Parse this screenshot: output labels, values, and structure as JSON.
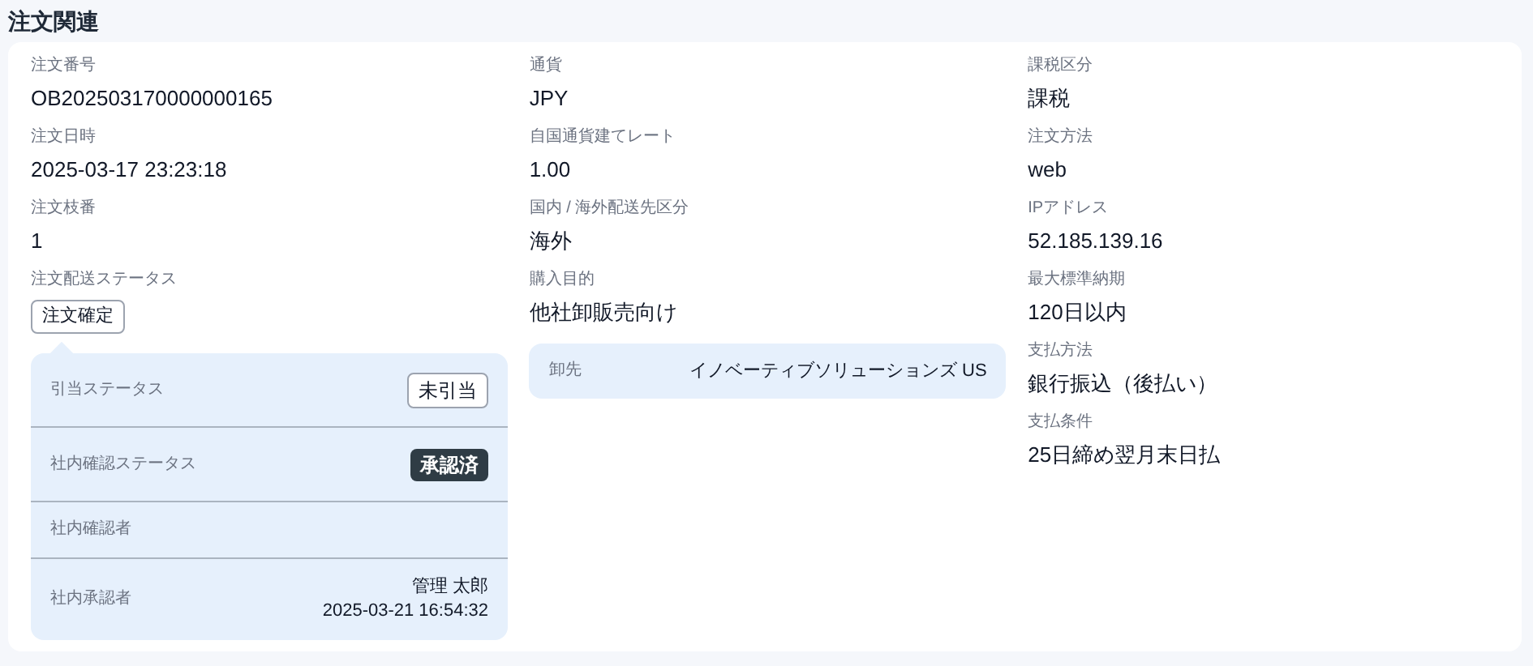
{
  "title": "注文関連",
  "columns": [
    {
      "fields": [
        {
          "label": "注文番号",
          "value": "OB202503170000000165"
        },
        {
          "label": "注文日時",
          "value": "2025-03-17 23:23:18"
        },
        {
          "label": "注文枝番",
          "value": "1"
        }
      ],
      "status": {
        "label": "注文配送ステータス",
        "badge": "注文確定"
      },
      "panel": {
        "pointer": true,
        "rows": [
          {
            "kind": "badge",
            "label": "引当ステータス",
            "value": "未引当"
          },
          {
            "kind": "solid",
            "label": "社内確認ステータス",
            "value": "承認済"
          },
          {
            "kind": "empty",
            "label": "社内確認者"
          },
          {
            "kind": "lines",
            "label": "社内承認者",
            "lines": [
              "管理 太郎",
              "2025-03-21 16:54:32"
            ]
          }
        ]
      }
    },
    {
      "fields": [
        {
          "label": "通貨",
          "value": "JPY"
        },
        {
          "label": "自国通貨建てレート",
          "value": "1.00"
        },
        {
          "label": "国内 / 海外配送先区分",
          "value": "海外"
        },
        {
          "label": "購入目的",
          "value": "他社卸販売向け"
        }
      ],
      "panel": {
        "pointer": false,
        "rows": [
          {
            "kind": "text",
            "label": "卸先",
            "value": "イノベーティブソリューションズ US"
          }
        ]
      }
    },
    {
      "fields": [
        {
          "label": "課税区分",
          "value": "課税"
        },
        {
          "label": "注文方法",
          "value": "web"
        },
        {
          "label": "IPアドレス",
          "value": "52.185.139.16"
        },
        {
          "label": "最大標準納期",
          "value": "120日以内"
        },
        {
          "label": "支払方法",
          "value": "銀行振込（後払い）"
        },
        {
          "label": "支払条件",
          "value": "25日締め翌月末日払"
        }
      ]
    }
  ]
}
